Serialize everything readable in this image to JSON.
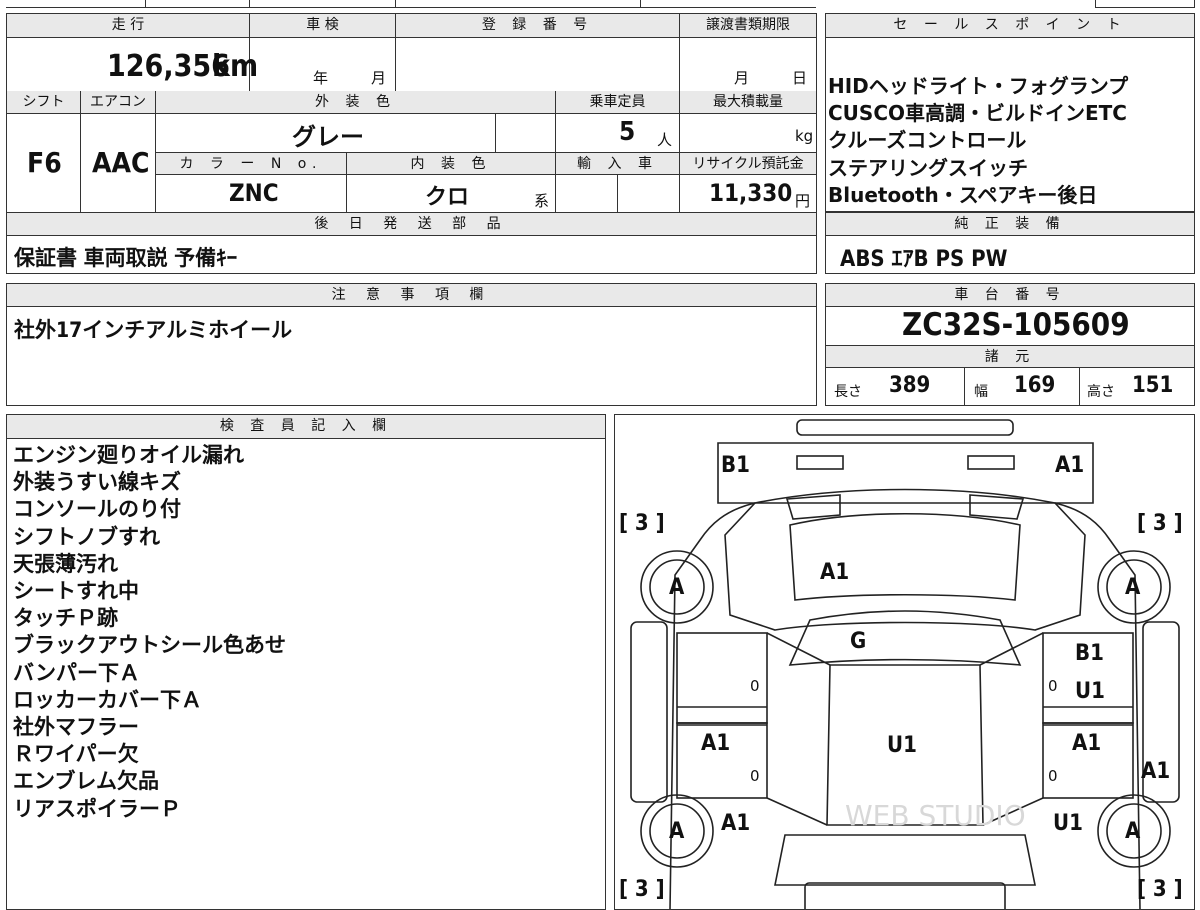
{
  "vehicle": {
    "mileage_label": "走 行",
    "mileage_value": "126,356",
    "mileage_unit": "km",
    "shaken_label": "車 検",
    "year_unit": "年",
    "month_unit": "月",
    "reg_number_label": "登 録 番 号",
    "transfer_deadline_label": "譲渡書類期限",
    "day_unit": "日",
    "shift_label": "シフト",
    "shift_value": "F6",
    "ac_label": "エアコン",
    "ac_value": "AAC",
    "exterior_color_label": "外 装 色",
    "exterior_color_value": "グレー",
    "capacity_label": "乗車定員",
    "capacity_value": "5",
    "capacity_unit": "人",
    "max_load_label": "最大積載量",
    "max_load_unit": "kg",
    "color_no_label": "カ ラ ー N o.",
    "color_no_value": "ZNC",
    "interior_color_label": "内 装 色",
    "interior_color_value": "クロ",
    "interior_suffix": "系",
    "import_label": "輸 入 車",
    "recycle_label": "リサイクル預託金",
    "recycle_value": "11,330",
    "recycle_unit": "円"
  },
  "later_parts": {
    "label": "後 日 発 送 部 品",
    "value": "保証書 車両取説 予備ｷｰ"
  },
  "notes": {
    "label": "注 意 事 項 欄",
    "value": "社外17インチアルミホイール"
  },
  "sales_points": {
    "label": "セ ー ル ス ポ イ ン ト",
    "items": [
      "HIDヘッドライト・フォグランプ",
      "CUSCO車高調・ビルドインETC",
      "クルーズコントロール",
      "ステアリングスイッチ",
      "Bluetooth・スペアキー後日"
    ]
  },
  "equipment": {
    "label": "純 正 装 備",
    "value": "ABS ｴｱB PS PW"
  },
  "chassis": {
    "label": "車 台 番 号",
    "value": "ZC32S-105609"
  },
  "specs": {
    "label": "諸 元",
    "length_label": "長さ",
    "length_value": "389",
    "width_label": "幅",
    "width_value": "169",
    "height_label": "高さ",
    "height_value": "151"
  },
  "inspector": {
    "label": "検 査 員 記 入 欄",
    "remarks": [
      "エンジン廻りオイル漏れ",
      "外装うすい線キズ",
      "コンソールのり付",
      "シフトノブすれ",
      "天張薄汚れ",
      "シートすれ中",
      "タッチＰ跡",
      "ブラックアウトシール色あせ",
      "バンパー下Ａ",
      "ロッカーカバー下Ａ",
      "社外マフラー",
      "Ｒワイパー欠",
      "エンブレム欠品",
      "リアスポイラーＰ"
    ]
  },
  "diagram": {
    "marks": {
      "front_bumper_left": "B1",
      "front_bumper_right": "A1",
      "hood": "A1",
      "windshield": "G",
      "right_front_door": "B1",
      "right_front_door_2": "U1",
      "roof": "U1",
      "left_rear_door": "A1",
      "right_rear_door": "A1",
      "right_side_sill": "A1",
      "left_rear_quarter": "A1",
      "right_rear_quarter": "U1",
      "tire_fl": "A",
      "tire_fr": "A",
      "tire_rl": "A",
      "tire_rr": "A",
      "tread_fl": "[ 3 ]",
      "tread_fr": "[ 3 ]",
      "tread_rl": "[ 3 ]",
      "tread_rr": "[ 3 ]",
      "zero": "0"
    },
    "watermark": "WEB STUDIO"
  }
}
